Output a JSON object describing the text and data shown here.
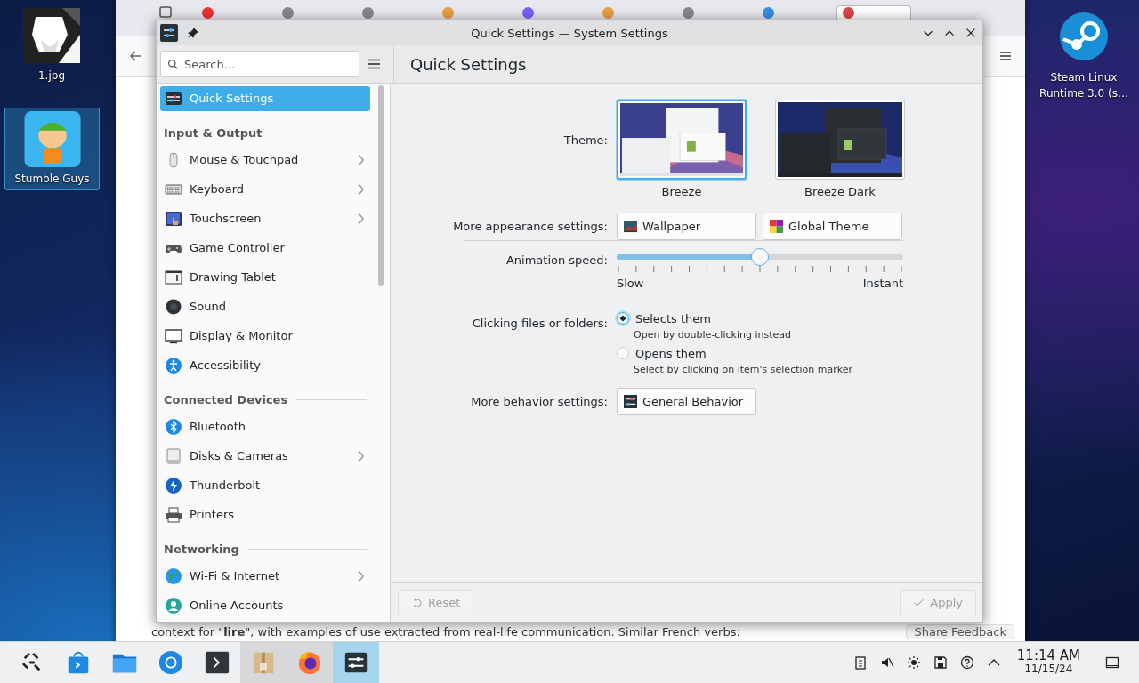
{
  "desktop": {
    "icons": [
      {
        "label": "1.jpg",
        "kind": "picture",
        "selected": false
      },
      {
        "label": "Stumble Guys",
        "kind": "game",
        "selected": true
      },
      {
        "label": "Steam Linux Runtime 3.0 (s…",
        "kind": "runtime",
        "selected": false
      }
    ]
  },
  "browser": {
    "tabs": [
      {
        "selected": false
      },
      {
        "selected": false
      },
      {
        "selected": false
      },
      {
        "selected": false
      },
      {
        "selected": false
      },
      {
        "selected": false
      },
      {
        "selected": false
      },
      {
        "selected": false
      },
      {
        "selected": true
      }
    ],
    "page_lines": [
      "context for \"**lire**\", with examples of use extracted from real-life communication. Similar French verbs:"
    ],
    "feedback_button": "Share Feedback"
  },
  "window": {
    "title": "Quick Settings — System Settings",
    "search": {
      "placeholder": "Search..."
    },
    "page_title": "Quick Settings",
    "sidebar": {
      "items": [
        {
          "kind": "item",
          "label": "Quick Settings",
          "selected": true,
          "expandable": false
        },
        {
          "kind": "header",
          "label": "Input & Output"
        },
        {
          "kind": "item",
          "label": "Mouse & Touchpad",
          "selected": false,
          "expandable": true
        },
        {
          "kind": "item",
          "label": "Keyboard",
          "selected": false,
          "expandable": true
        },
        {
          "kind": "item",
          "label": "Touchscreen",
          "selected": false,
          "expandable": true
        },
        {
          "kind": "item",
          "label": "Game Controller",
          "selected": false,
          "expandable": false
        },
        {
          "kind": "item",
          "label": "Drawing Tablet",
          "selected": false,
          "expandable": false
        },
        {
          "kind": "item",
          "label": "Sound",
          "selected": false,
          "expandable": false
        },
        {
          "kind": "item",
          "label": "Display & Monitor",
          "selected": false,
          "expandable": false
        },
        {
          "kind": "item",
          "label": "Accessibility",
          "selected": false,
          "expandable": false
        },
        {
          "kind": "header",
          "label": "Connected Devices"
        },
        {
          "kind": "item",
          "label": "Bluetooth",
          "selected": false,
          "expandable": false
        },
        {
          "kind": "item",
          "label": "Disks & Cameras",
          "selected": false,
          "expandable": true
        },
        {
          "kind": "item",
          "label": "Thunderbolt",
          "selected": false,
          "expandable": false
        },
        {
          "kind": "item",
          "label": "Printers",
          "selected": false,
          "expandable": false
        },
        {
          "kind": "header",
          "label": "Networking"
        },
        {
          "kind": "item",
          "label": "Wi-Fi & Internet",
          "selected": false,
          "expandable": true
        },
        {
          "kind": "item",
          "label": "Online Accounts",
          "selected": false,
          "expandable": false
        }
      ]
    },
    "content": {
      "theme": {
        "label": "Theme:",
        "options": [
          {
            "label": "Breeze",
            "selected": true
          },
          {
            "label": "Breeze Dark",
            "selected": false
          }
        ]
      },
      "appearance": {
        "label": "More appearance settings:",
        "buttons": [
          "Wallpaper",
          "Global Theme"
        ]
      },
      "animation": {
        "label": "Animation speed:",
        "level": 0.5,
        "min_label": "Slow",
        "max_label": "Instant"
      },
      "clicking": {
        "label": "Clicking files or folders:",
        "options": [
          {
            "label": "Selects them",
            "description": "Open by double-clicking instead",
            "selected": true
          },
          {
            "label": "Opens them",
            "description": "Select by clicking on item's selection marker",
            "selected": false
          }
        ]
      },
      "behavior": {
        "label": "More behavior settings:",
        "button": "General Behavior"
      }
    },
    "footer": {
      "buttons": [
        {
          "label": "Reset",
          "kind": "reset",
          "disabled": true
        },
        {
          "label": "Apply",
          "kind": "apply",
          "disabled": true
        }
      ]
    }
  },
  "taskbar": {
    "tasks": [
      {
        "kind": "launcher",
        "open": false,
        "selected": false
      },
      {
        "kind": "store",
        "open": false,
        "selected": false
      },
      {
        "kind": "files",
        "open": false,
        "selected": false
      },
      {
        "kind": "browser",
        "open": false,
        "selected": false
      },
      {
        "kind": "terminal",
        "open": false,
        "selected": false
      },
      {
        "kind": "archive",
        "open": true,
        "selected": false
      },
      {
        "kind": "firefox",
        "open": true,
        "selected": false
      },
      {
        "kind": "settings",
        "open": true,
        "selected": true
      }
    ],
    "time": "11:14 AM",
    "date": "11/15/24"
  }
}
